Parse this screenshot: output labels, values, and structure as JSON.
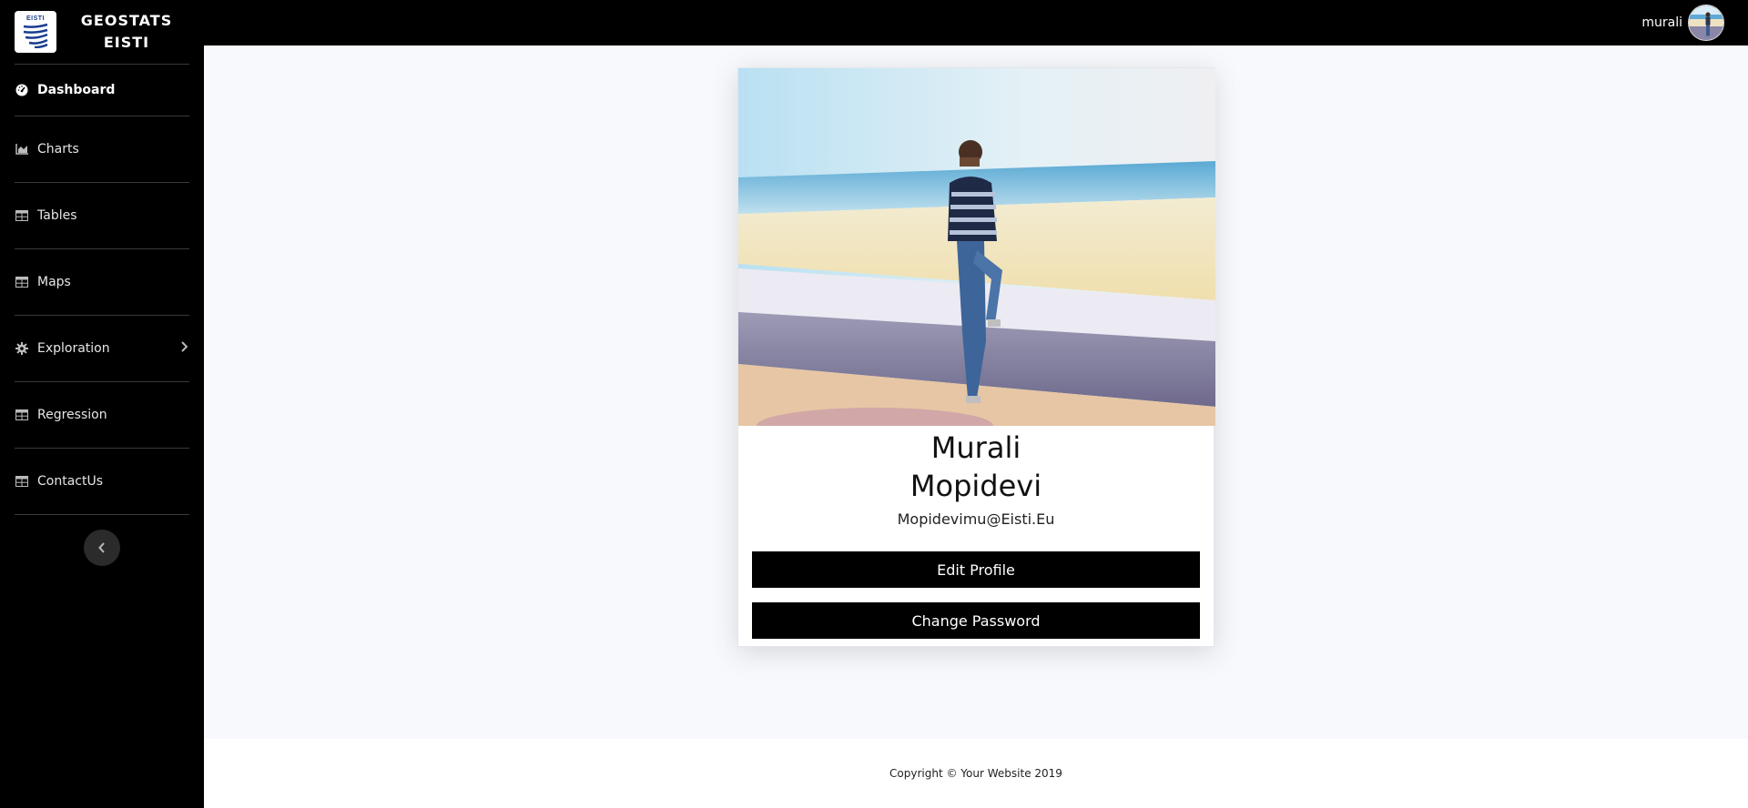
{
  "brand": {
    "logo_text": "EISTI",
    "line1": "GEOSTATS",
    "line2": "EISTI"
  },
  "sidebar": {
    "items": [
      {
        "label": "Dashboard",
        "icon": "tachometer-icon"
      },
      {
        "label": "Charts",
        "icon": "area-chart-icon"
      },
      {
        "label": "Tables",
        "icon": "table-icon"
      },
      {
        "label": "Maps",
        "icon": "table-icon"
      },
      {
        "label": "Exploration",
        "icon": "gear-icon"
      },
      {
        "label": "Regression",
        "icon": "table-icon"
      },
      {
        "label": "ContactUs",
        "icon": "table-icon"
      }
    ]
  },
  "topbar": {
    "username": "murali"
  },
  "profile": {
    "first_name": "Murali",
    "last_name": "Mopidevi",
    "email": "Mopidevimu@Eisti.Eu",
    "edit_label": "Edit Profile",
    "password_label": "Change Password"
  },
  "footer": {
    "copyright": "Copyright © Your Website 2019"
  }
}
